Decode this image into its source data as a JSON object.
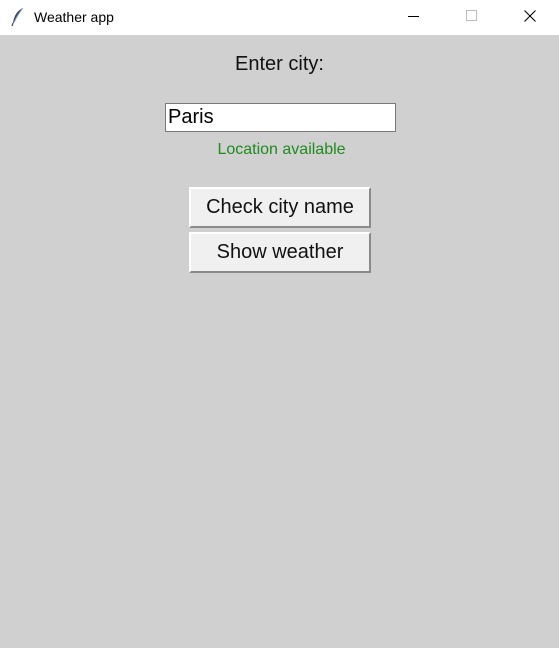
{
  "window": {
    "title": "Weather app",
    "controls": {
      "minimize": "minimize-icon",
      "maximize": "maximize-icon",
      "close": "close-icon"
    }
  },
  "form": {
    "prompt_label": "Enter city:",
    "city_value": "Paris",
    "status_text": "Location available",
    "status_color": "#1f8a1f",
    "check_button_label": "Check city name",
    "weather_button_label": "Show weather"
  },
  "colors": {
    "background": "#d0d0d0",
    "titlebar": "#ffffff",
    "button_face": "#f0f0f0"
  }
}
